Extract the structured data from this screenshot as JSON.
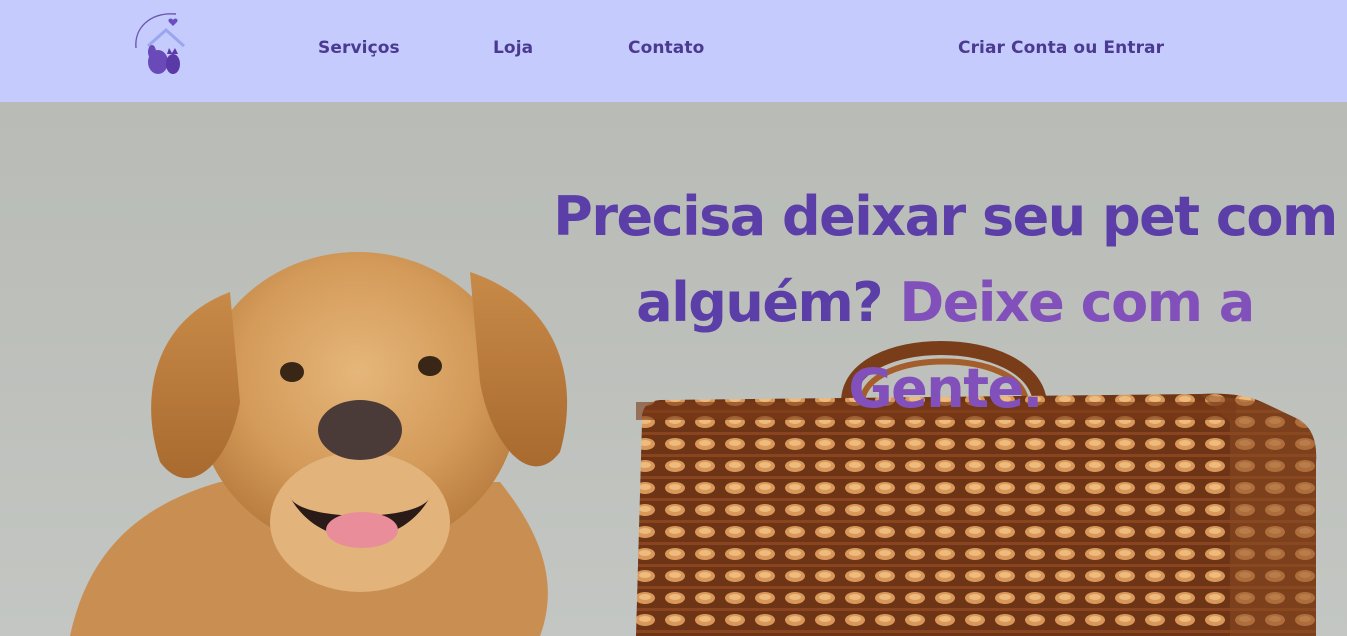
{
  "header": {
    "logo_icon": "pet-house-logo-icon",
    "nav": {
      "services": "Serviços",
      "store": "Loja",
      "contact": "Contato",
      "login": "Criar Conta ou Entrar"
    }
  },
  "hero": {
    "headline_part1": "Precisa deixar seu pet com alguém?",
    "headline_part2": "Deixe com a Gente.",
    "image": "dog-and-wicker-suitcase-photo"
  },
  "colors": {
    "navbar_bg": "#c6cbfd",
    "nav_text": "#4b3a92",
    "headline_primary": "#5b3ea8",
    "headline_accent": "#8250bb"
  }
}
